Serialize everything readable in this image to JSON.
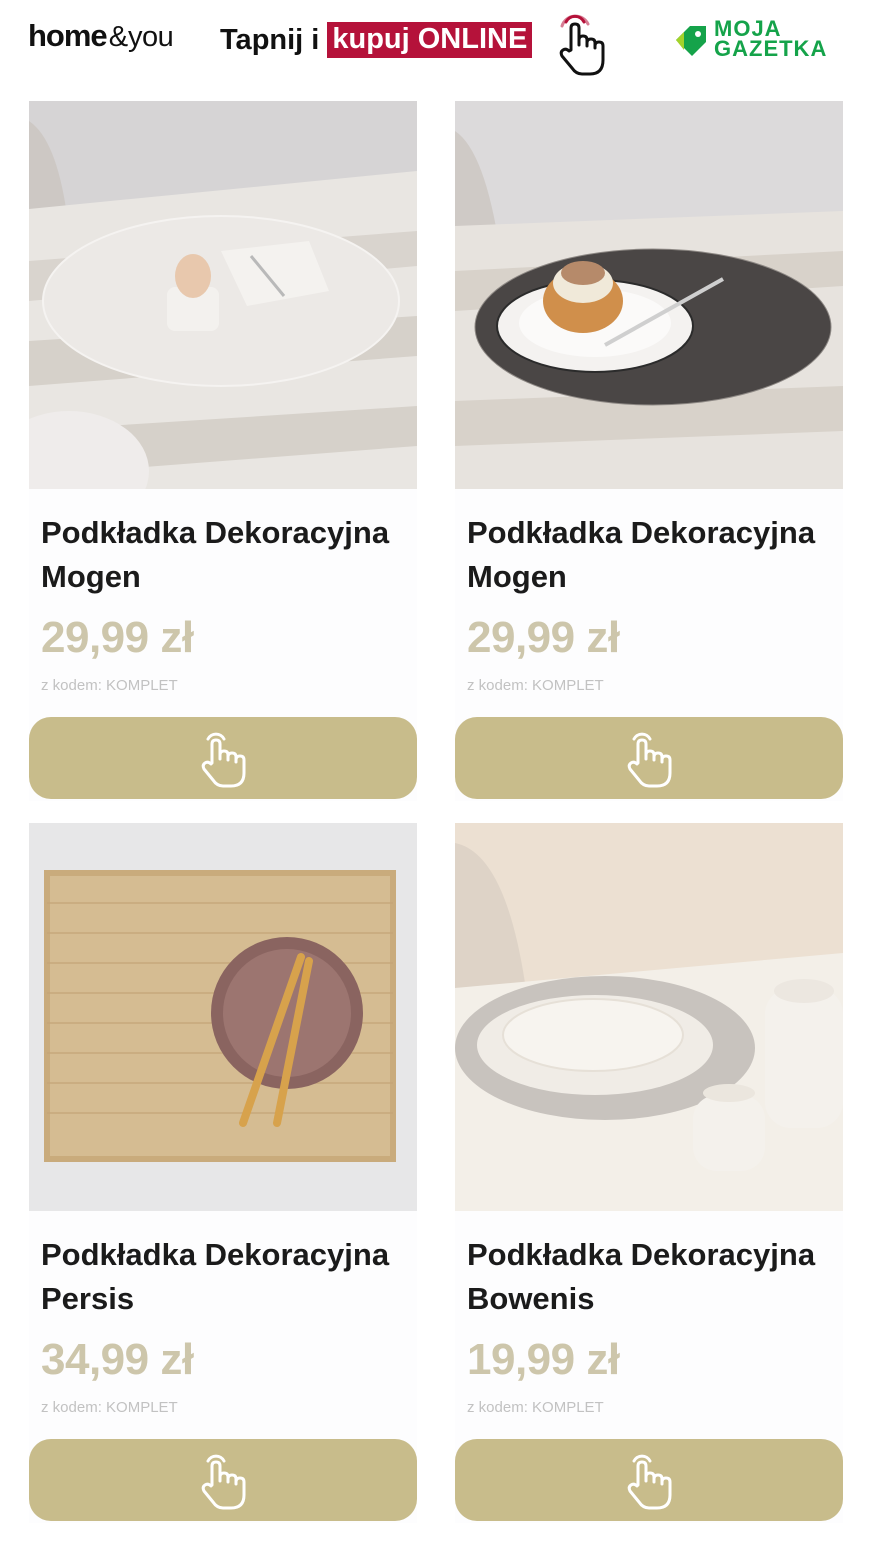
{
  "header": {
    "brand_home": "home",
    "brand_amp": "&",
    "brand_you": "you",
    "tap_text": "Tapnij i",
    "tap_highlight": "kupuj ONLINE",
    "gazetka_line1": "MOJA",
    "gazetka_line2": "GAZETKA",
    "tap_icon": "tap-hand-icon",
    "gazetka_icon": "tag-icon"
  },
  "colors": {
    "highlight": "#b5123a",
    "price": "#cdc6ab",
    "button": "#c8bc8b",
    "gazetka_green": "#15a34a"
  },
  "products": [
    {
      "name": "Podkładka Dekoracyjna Mogen",
      "price": "29,99 zł",
      "code": "z kodem: KOMPLET",
      "button_icon": "tap-hand-icon"
    },
    {
      "name": "Podkładka Dekoracyjna Mogen",
      "price": "29,99 zł",
      "code": "z kodem: KOMPLET",
      "button_icon": "tap-hand-icon"
    },
    {
      "name": "Podkładka Dekoracyjna Persis",
      "price": "34,99 zł",
      "code": "z kodem: KOMPLET",
      "button_icon": "tap-hand-icon"
    },
    {
      "name": "Podkładka Dekoracyjna Bowenis",
      "price": "19,99 zł",
      "code": "z kodem: KOMPLET",
      "button_icon": "tap-hand-icon"
    }
  ]
}
